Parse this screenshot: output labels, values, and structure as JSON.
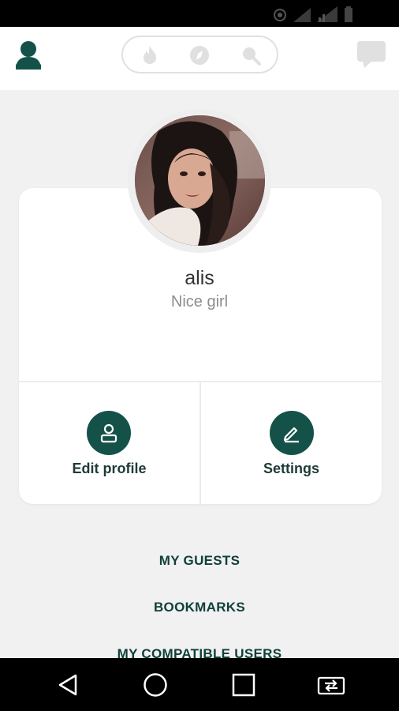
{
  "status_bar": {
    "icons": [
      "location-icon",
      "signal-icon",
      "signal-icon",
      "battery-icon"
    ]
  },
  "top_bar": {
    "icons": [
      "profile-icon",
      "fire-icon",
      "compass-icon",
      "search-icon",
      "chat-icon"
    ],
    "accent_color": "#145249",
    "inactive_icon_color": "#e0e0e0"
  },
  "profile": {
    "username": "alis",
    "bio": "Nice girl",
    "actions": [
      {
        "label": "Edit profile",
        "icon": "user-edit-icon"
      },
      {
        "label": "Settings",
        "icon": "pencil-icon"
      }
    ]
  },
  "menu": {
    "items": [
      "MY GUESTS",
      "BOOKMARKS",
      "MY COMPATIBLE USERS"
    ]
  },
  "nav_bar": {
    "icons": [
      "back-icon",
      "home-icon",
      "recents-icon",
      "switch-icon"
    ]
  }
}
